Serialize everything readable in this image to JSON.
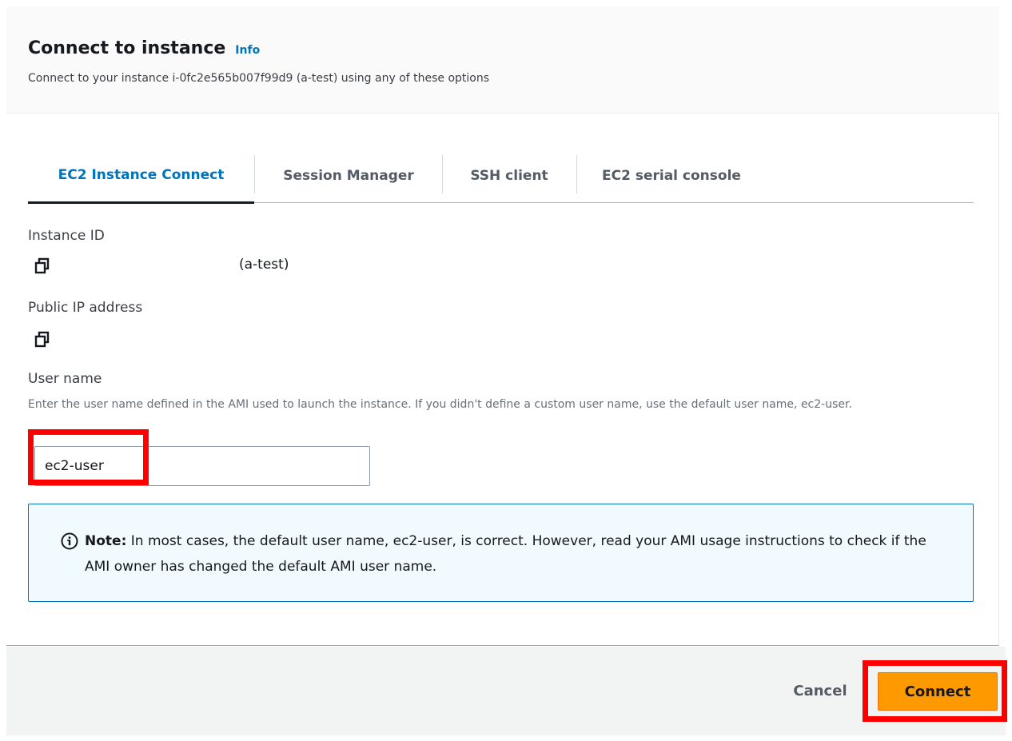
{
  "header": {
    "title": "Connect to instance",
    "info_link": "Info",
    "subtitle": "Connect to your instance i-0fc2e565b007f99d9 (a-test) using any of these options"
  },
  "tabs": [
    {
      "label": "EC2 Instance Connect",
      "active": true
    },
    {
      "label": "Session Manager",
      "active": false
    },
    {
      "label": "SSH client",
      "active": false
    },
    {
      "label": "EC2 serial console",
      "active": false
    }
  ],
  "instance": {
    "id_label": "Instance ID",
    "name": "(a-test)",
    "ip_label": "Public IP address"
  },
  "username": {
    "label": "User name",
    "hint": "Enter the user name defined in the AMI used to launch the instance. If you didn't define a custom user name, use the default user name, ec2-user.",
    "value": "ec2-user"
  },
  "note": {
    "strong": "Note:",
    "text": " In most cases, the default user name, ec2-user, is correct. However, read your AMI usage instructions to check if the AMI owner has changed the default AMI user name."
  },
  "footer": {
    "cancel_label": "Cancel",
    "connect_label": "Connect"
  },
  "colors": {
    "accent": "#0073bb",
    "primary_button": "#ff9900",
    "highlight": "#ff0000"
  },
  "icons": {
    "copy": "copy-icon",
    "info": "info-circle-icon"
  }
}
